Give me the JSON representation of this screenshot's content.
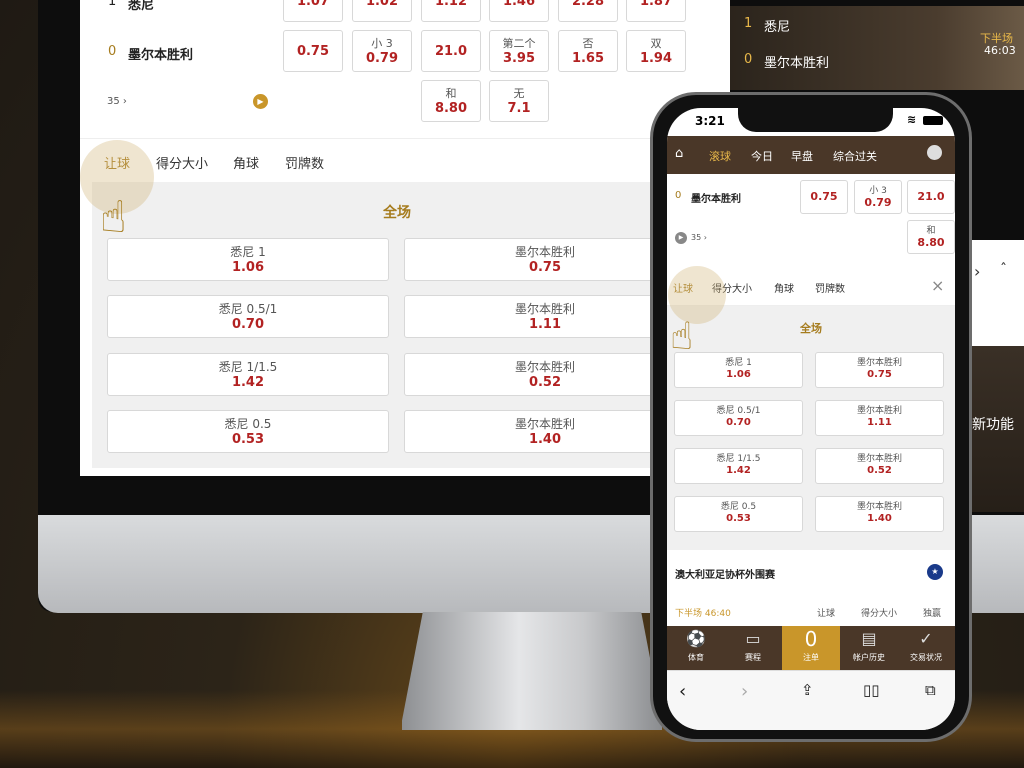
{
  "desktop": {
    "top_row": {
      "team1_num": "1",
      "team1": "悉尼",
      "odds": [
        "1.07",
        "1.02",
        "1.12",
        "1.46",
        "2.28",
        "1.87"
      ]
    },
    "row2": {
      "team_num": "0",
      "team": "墨尔本胜利",
      "odds": [
        {
          "sub": "",
          "val": "0.75"
        },
        {
          "sub": "小 3",
          "val": "0.79"
        },
        {
          "sub": "",
          "val": "21.0"
        },
        {
          "sub": "第二个",
          "val": "3.95"
        },
        {
          "sub": "否",
          "val": "1.65"
        },
        {
          "sub": "双",
          "val": "1.94"
        }
      ]
    },
    "row3": {
      "minute": "35",
      "odds": [
        {
          "sub": "和",
          "val": "8.80"
        },
        {
          "sub": "无",
          "val": "7.1"
        }
      ]
    },
    "tabs": [
      "让球",
      "得分大小",
      "角球",
      "罚牌数"
    ],
    "section_title": "全场",
    "grid": [
      {
        "l": {
          "label": "悉尼 1",
          "val": "1.06"
        },
        "r": {
          "label": "墨尔本胜利",
          "val": "0.75"
        }
      },
      {
        "l": {
          "label": "悉尼 0.5/1",
          "val": "0.70"
        },
        "r": {
          "label": "墨尔本胜利",
          "val": "1.11"
        }
      },
      {
        "l": {
          "label": "悉尼 1/1.5",
          "val": "1.42"
        },
        "r": {
          "label": "墨尔本胜利",
          "val": "0.52"
        }
      },
      {
        "l": {
          "label": "悉尼 0.5",
          "val": "0.53"
        },
        "r": {
          "label": "墨尔本胜利",
          "val": "1.40"
        }
      }
    ]
  },
  "video": {
    "team1_num": "1",
    "team1": "悉尼",
    "team2_num": "0",
    "team2": "墨尔本胜利",
    "period": "下半场",
    "time": "46:03"
  },
  "side_text": "新功能",
  "phone": {
    "time": "3:21",
    "nav": [
      "滚球",
      "今日",
      "早盘",
      "综合过关"
    ],
    "row": {
      "team_num": "0",
      "team": "墨尔本胜利",
      "odds": [
        {
          "sub": "",
          "val": "0.75"
        },
        {
          "sub": "小 3",
          "val": "0.79"
        },
        {
          "sub": "",
          "val": "21.0"
        }
      ],
      "minute": "35",
      "extra": {
        "sub": "和",
        "val": "8.80"
      }
    },
    "tabs": [
      "让球",
      "得分大小",
      "角球",
      "罚牌数"
    ],
    "section_title": "全场",
    "grid": [
      {
        "l": {
          "label": "悉尼 1",
          "val": "1.06"
        },
        "r": {
          "label": "墨尔本胜利",
          "val": "0.75"
        }
      },
      {
        "l": {
          "label": "悉尼 0.5/1",
          "val": "0.70"
        },
        "r": {
          "label": "墨尔本胜利",
          "val": "1.11"
        }
      },
      {
        "l": {
          "label": "悉尼 1/1.5",
          "val": "1.42"
        },
        "r": {
          "label": "墨尔本胜利",
          "val": "0.52"
        }
      },
      {
        "l": {
          "label": "悉尼 0.5",
          "val": "0.53"
        },
        "r": {
          "label": "墨尔本胜利",
          "val": "1.40"
        }
      }
    ],
    "league": "澳大利亚足协杯外围赛",
    "league_status": "下半场 46:40",
    "league_links": [
      "让球",
      "得分大小",
      "独赢"
    ],
    "bottom": [
      {
        "icon": "⚽",
        "label": "体育"
      },
      {
        "icon": "▭",
        "label": "赛程"
      },
      {
        "icon": "0",
        "label": "注单"
      },
      {
        "icon": "▤",
        "label": "帐户历史"
      },
      {
        "icon": "✓",
        "label": "交易状况"
      }
    ],
    "colors": {
      "brand": "#4a3728",
      "accent": "#c9962a",
      "odds": "#b22222"
    }
  }
}
